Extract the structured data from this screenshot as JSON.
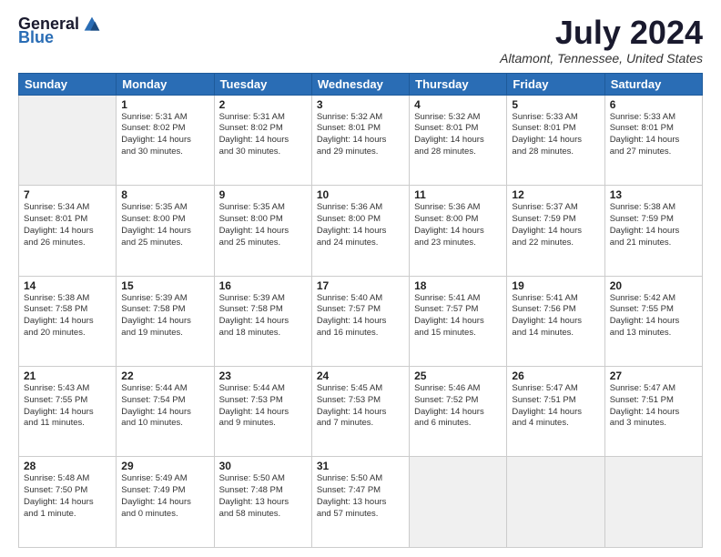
{
  "header": {
    "logo_general": "General",
    "logo_blue": "Blue",
    "month_title": "July 2024",
    "location": "Altamont, Tennessee, United States"
  },
  "days_of_week": [
    "Sunday",
    "Monday",
    "Tuesday",
    "Wednesday",
    "Thursday",
    "Friday",
    "Saturday"
  ],
  "weeks": [
    [
      {
        "day": "",
        "info": "",
        "empty": true
      },
      {
        "day": "1",
        "info": "Sunrise: 5:31 AM\nSunset: 8:02 PM\nDaylight: 14 hours\nand 30 minutes."
      },
      {
        "day": "2",
        "info": "Sunrise: 5:31 AM\nSunset: 8:02 PM\nDaylight: 14 hours\nand 30 minutes."
      },
      {
        "day": "3",
        "info": "Sunrise: 5:32 AM\nSunset: 8:01 PM\nDaylight: 14 hours\nand 29 minutes."
      },
      {
        "day": "4",
        "info": "Sunrise: 5:32 AM\nSunset: 8:01 PM\nDaylight: 14 hours\nand 28 minutes."
      },
      {
        "day": "5",
        "info": "Sunrise: 5:33 AM\nSunset: 8:01 PM\nDaylight: 14 hours\nand 28 minutes."
      },
      {
        "day": "6",
        "info": "Sunrise: 5:33 AM\nSunset: 8:01 PM\nDaylight: 14 hours\nand 27 minutes."
      }
    ],
    [
      {
        "day": "7",
        "info": "Sunrise: 5:34 AM\nSunset: 8:01 PM\nDaylight: 14 hours\nand 26 minutes."
      },
      {
        "day": "8",
        "info": "Sunrise: 5:35 AM\nSunset: 8:00 PM\nDaylight: 14 hours\nand 25 minutes."
      },
      {
        "day": "9",
        "info": "Sunrise: 5:35 AM\nSunset: 8:00 PM\nDaylight: 14 hours\nand 25 minutes."
      },
      {
        "day": "10",
        "info": "Sunrise: 5:36 AM\nSunset: 8:00 PM\nDaylight: 14 hours\nand 24 minutes."
      },
      {
        "day": "11",
        "info": "Sunrise: 5:36 AM\nSunset: 8:00 PM\nDaylight: 14 hours\nand 23 minutes."
      },
      {
        "day": "12",
        "info": "Sunrise: 5:37 AM\nSunset: 7:59 PM\nDaylight: 14 hours\nand 22 minutes."
      },
      {
        "day": "13",
        "info": "Sunrise: 5:38 AM\nSunset: 7:59 PM\nDaylight: 14 hours\nand 21 minutes."
      }
    ],
    [
      {
        "day": "14",
        "info": "Sunrise: 5:38 AM\nSunset: 7:58 PM\nDaylight: 14 hours\nand 20 minutes."
      },
      {
        "day": "15",
        "info": "Sunrise: 5:39 AM\nSunset: 7:58 PM\nDaylight: 14 hours\nand 19 minutes."
      },
      {
        "day": "16",
        "info": "Sunrise: 5:39 AM\nSunset: 7:58 PM\nDaylight: 14 hours\nand 18 minutes."
      },
      {
        "day": "17",
        "info": "Sunrise: 5:40 AM\nSunset: 7:57 PM\nDaylight: 14 hours\nand 16 minutes."
      },
      {
        "day": "18",
        "info": "Sunrise: 5:41 AM\nSunset: 7:57 PM\nDaylight: 14 hours\nand 15 minutes."
      },
      {
        "day": "19",
        "info": "Sunrise: 5:41 AM\nSunset: 7:56 PM\nDaylight: 14 hours\nand 14 minutes."
      },
      {
        "day": "20",
        "info": "Sunrise: 5:42 AM\nSunset: 7:55 PM\nDaylight: 14 hours\nand 13 minutes."
      }
    ],
    [
      {
        "day": "21",
        "info": "Sunrise: 5:43 AM\nSunset: 7:55 PM\nDaylight: 14 hours\nand 11 minutes."
      },
      {
        "day": "22",
        "info": "Sunrise: 5:44 AM\nSunset: 7:54 PM\nDaylight: 14 hours\nand 10 minutes."
      },
      {
        "day": "23",
        "info": "Sunrise: 5:44 AM\nSunset: 7:53 PM\nDaylight: 14 hours\nand 9 minutes."
      },
      {
        "day": "24",
        "info": "Sunrise: 5:45 AM\nSunset: 7:53 PM\nDaylight: 14 hours\nand 7 minutes."
      },
      {
        "day": "25",
        "info": "Sunrise: 5:46 AM\nSunset: 7:52 PM\nDaylight: 14 hours\nand 6 minutes."
      },
      {
        "day": "26",
        "info": "Sunrise: 5:47 AM\nSunset: 7:51 PM\nDaylight: 14 hours\nand 4 minutes."
      },
      {
        "day": "27",
        "info": "Sunrise: 5:47 AM\nSunset: 7:51 PM\nDaylight: 14 hours\nand 3 minutes."
      }
    ],
    [
      {
        "day": "28",
        "info": "Sunrise: 5:48 AM\nSunset: 7:50 PM\nDaylight: 14 hours\nand 1 minute."
      },
      {
        "day": "29",
        "info": "Sunrise: 5:49 AM\nSunset: 7:49 PM\nDaylight: 14 hours\nand 0 minutes."
      },
      {
        "day": "30",
        "info": "Sunrise: 5:50 AM\nSunset: 7:48 PM\nDaylight: 13 hours\nand 58 minutes."
      },
      {
        "day": "31",
        "info": "Sunrise: 5:50 AM\nSunset: 7:47 PM\nDaylight: 13 hours\nand 57 minutes."
      },
      {
        "day": "",
        "info": "",
        "empty": true
      },
      {
        "day": "",
        "info": "",
        "empty": true
      },
      {
        "day": "",
        "info": "",
        "empty": true
      }
    ]
  ]
}
